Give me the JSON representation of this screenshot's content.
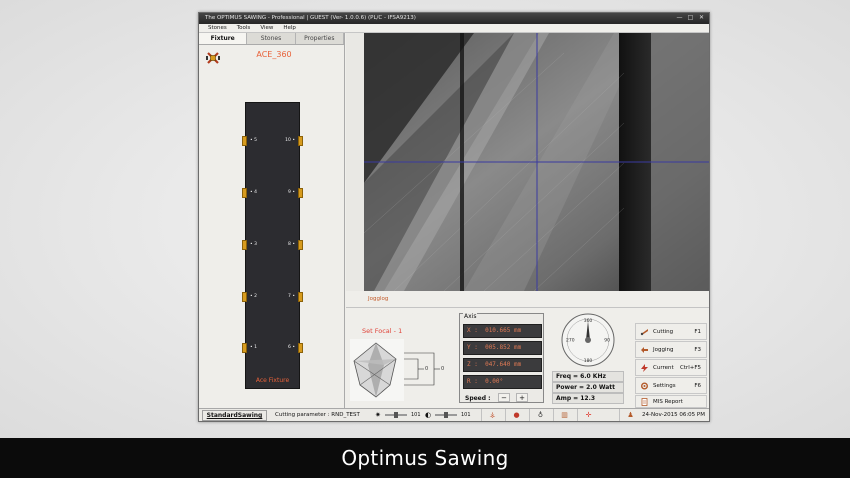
{
  "window": {
    "title": "The OPTIMUS SAWING - Professional  | GUEST (Ver- 1.0.0.6)       (PL/C - IFSA9213)",
    "controls": [
      "—",
      "□",
      "✕"
    ]
  },
  "menu": [
    "Stones",
    "Tools",
    "View",
    "Help"
  ],
  "left_tabs": [
    "Fixture",
    "Stones",
    "Properties"
  ],
  "fixture": {
    "name": "ACE_360",
    "plate_label": "Ace Fixture",
    "left_slots": [
      "5",
      "4",
      "3",
      "2",
      "1"
    ],
    "right_slots": [
      "10",
      "9",
      "8",
      "7",
      "6"
    ]
  },
  "camera": {
    "jog_label": "Jogglog"
  },
  "focal": {
    "label": "Set Focal - 1",
    "value_a": "0",
    "value_b": "0"
  },
  "axis": {
    "title": "Axis",
    "rows": [
      {
        "axis": "X",
        "value": "010.665 mm"
      },
      {
        "axis": "Y",
        "value": "005.852 mm"
      },
      {
        "axis": "Z",
        "value": "047.640 mm"
      },
      {
        "axis": "R",
        "value": "0.00°"
      }
    ],
    "speed_label": "Speed :",
    "speed_minus": "−",
    "speed_plus": "+"
  },
  "gauge": {
    "top": "360",
    "left": "270",
    "right": "90",
    "bottom": "180"
  },
  "readings": [
    {
      "label": "Freq",
      "value": "= 6.0 KHz"
    },
    {
      "label": "Power",
      "value": "= 2.0 Watt"
    },
    {
      "label": "Amp",
      "value": "= 12.3"
    }
  ],
  "side_buttons": [
    {
      "label": "Cutting",
      "key": "F1"
    },
    {
      "label": "Jogging",
      "key": "F3"
    },
    {
      "label": "Current",
      "key": "Ctrl+F5"
    },
    {
      "label": "Settings",
      "key": "F6"
    },
    {
      "label": "MIS Report",
      "key": ""
    }
  ],
  "status": {
    "mode": "StandardSawing",
    "cutting_param": "Cutting parameter : RND_TEST",
    "slider1_value": "101",
    "slider2_value": "101",
    "datetime": "24-Nov-2015 06:05 PM"
  },
  "caption": "Optimus Sawing",
  "colors": {
    "accent": "#e8623a",
    "crosshair": "#3a3aa0",
    "gold": "#d79b1e"
  }
}
